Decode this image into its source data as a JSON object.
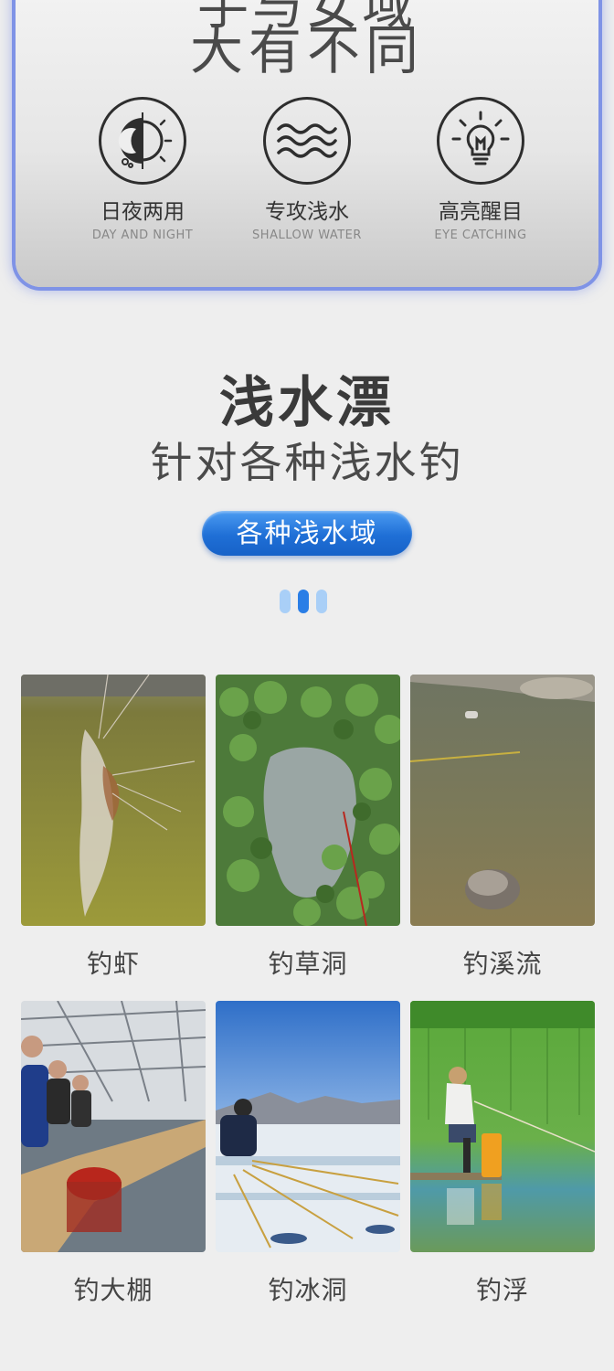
{
  "feature_card": {
    "title_top": "手与女域",
    "title": "大有不同",
    "features": [
      {
        "icon": "day-night-icon",
        "cn": "日夜两用",
        "en": "DAY AND NIGHT"
      },
      {
        "icon": "wave-icon",
        "cn": "专攻浅水",
        "en": "SHALLOW WATER"
      },
      {
        "icon": "bulb-icon",
        "cn": "高亮醒目",
        "en": "EYE CATCHING"
      }
    ]
  },
  "headline": "浅水漂",
  "subheadline": "针对各种浅水钓",
  "pill_label": "各种浅水域",
  "pager": {
    "count": 3,
    "active": 1
  },
  "grid": [
    {
      "caption": "钓虾",
      "scene": "shrimp"
    },
    {
      "caption": "钓草洞",
      "scene": "weed-hole"
    },
    {
      "caption": "钓溪流",
      "scene": "stream"
    },
    {
      "caption": "钓大棚",
      "scene": "greenhouse"
    },
    {
      "caption": "钓冰洞",
      "scene": "ice-hole"
    },
    {
      "caption": "钓浮",
      "scene": "float"
    }
  ],
  "colors": {
    "accent": "#1f6fd6",
    "card_border": "#7f93e6"
  }
}
